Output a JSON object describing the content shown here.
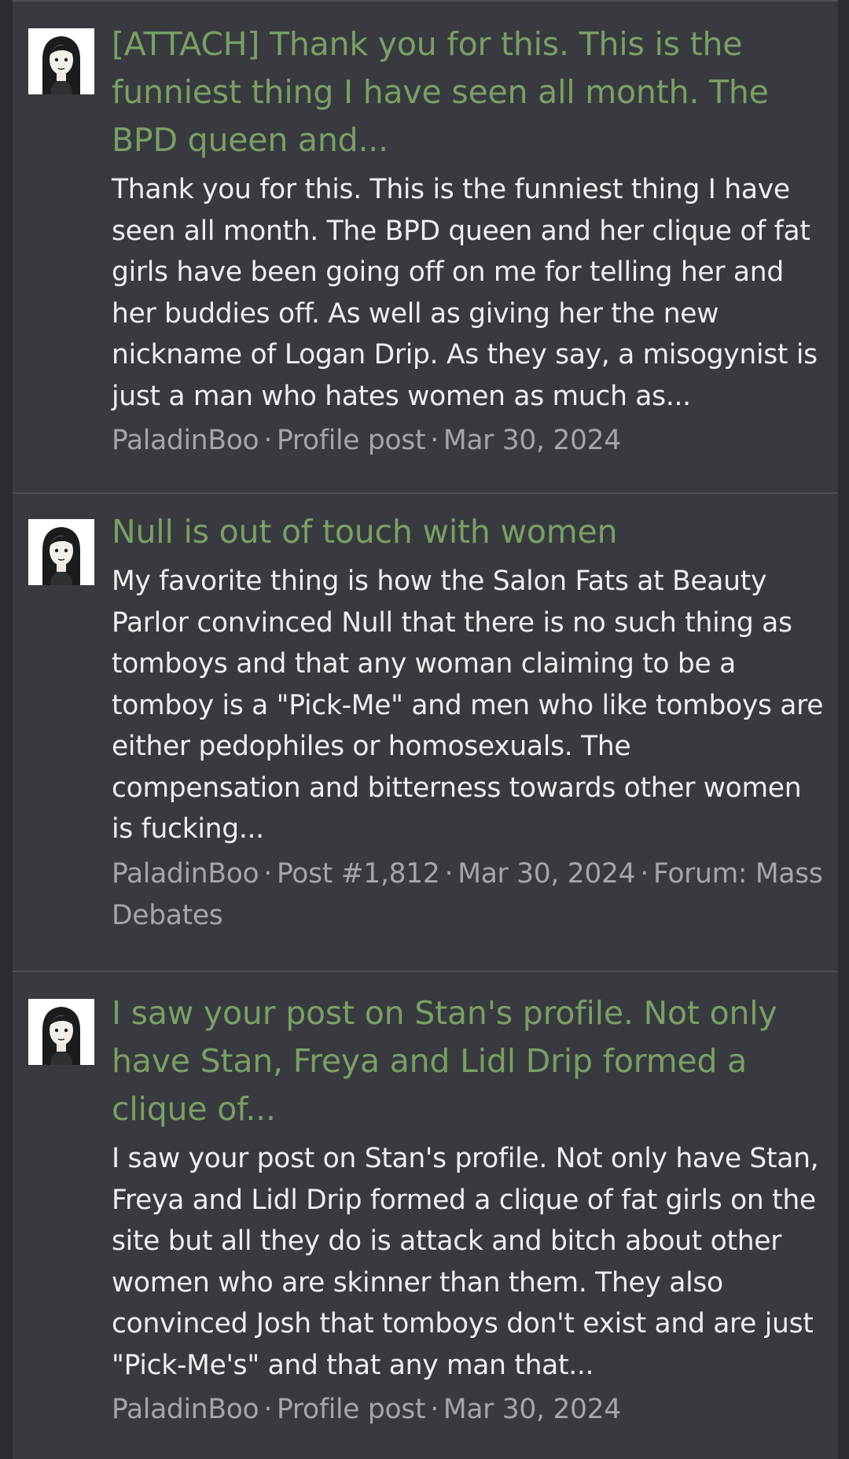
{
  "separator": "·",
  "results": [
    {
      "title": "[ATTACH] Thank you for this. This is the funniest thing I have seen all month. The BPD queen and...",
      "snippet": "Thank you for this. This is the funniest thing I have seen all month. The BPD queen and her clique of fat girls have been going off on me for telling her and her buddies off. As well as giving her the new nickname of Logan Drip. As they say, a misogynist is just a man who hates women as much as...",
      "author": "PaladinBoo",
      "type": "Profile post",
      "date": "Mar 30, 2024"
    },
    {
      "title": "Null is out of touch with women",
      "snippet": "My favorite thing is how the Salon Fats at Beauty Parlor convinced Null that there is no such thing as tomboys and that any woman claiming to be a tomboy is a \"Pick-Me\" and men who like tomboys are either pedophiles or homosexuals. The compensation and bitterness towards other women is fucking...",
      "author": "PaladinBoo",
      "type": "Post #1,812",
      "date": "Mar 30, 2024",
      "forum_label": "Forum:",
      "forum": "Mass Debates"
    },
    {
      "title": "I saw your post on Stan's profile. Not only have Stan, Freya and Lidl Drip formed a clique of...",
      "snippet": "I saw your post on Stan's profile. Not only have Stan, Freya and Lidl Drip formed a clique of fat girls on the site but all they do is attack and bitch about other women who are skinner than them. They also convinced Josh that tomboys don't exist and are just \"Pick-Me's\" and that any man that...",
      "author": "PaladinBoo",
      "type": "Profile post",
      "date": "Mar 30, 2024"
    }
  ],
  "colors": {
    "page_background": "#2a2c30",
    "panel_background": "#383a3f",
    "title_link": "#7a9f66",
    "snippet_text": "#eceef0",
    "meta_text": "#a3a6aa"
  },
  "icons": {
    "avatar": "user-avatar-drawing"
  }
}
